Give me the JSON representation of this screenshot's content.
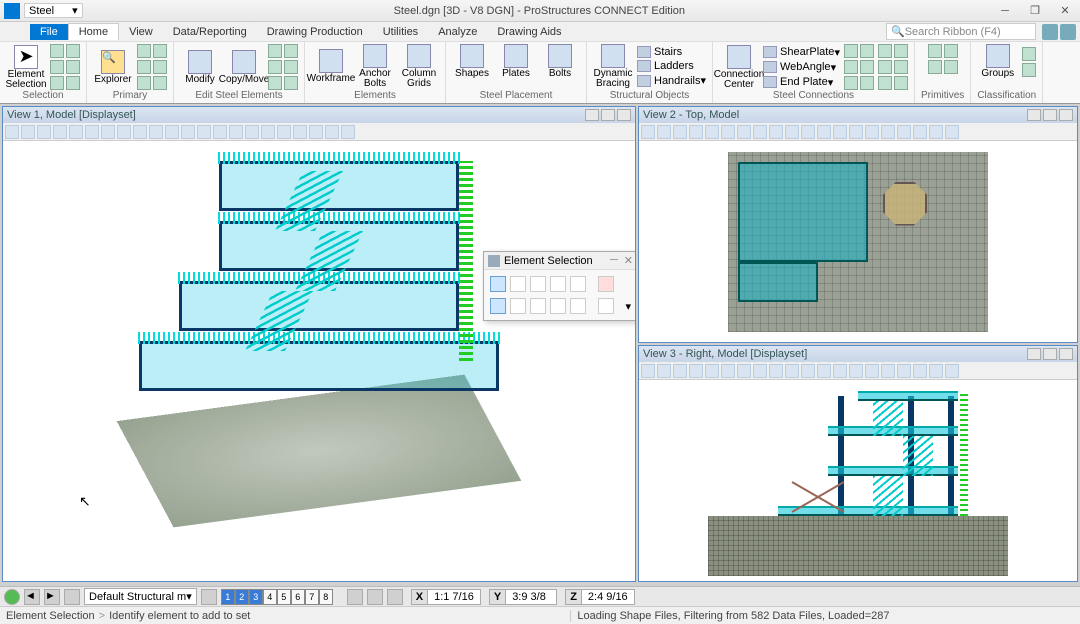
{
  "title": {
    "doc_name": "Steel",
    "center": "Steel.dgn [3D - V8 DGN] - ProStructures CONNECT Edition"
  },
  "win_btns": {
    "min": "─",
    "max": "❐",
    "close": "✕"
  },
  "menubar": {
    "file": "File",
    "tabs": [
      "Home",
      "View",
      "Data/Reporting",
      "Drawing Production",
      "Utilities",
      "Analyze",
      "Drawing Aids"
    ],
    "search_ph": "Search Ribbon (F4)"
  },
  "ribbon": {
    "selection": {
      "element": "Element\nSelection",
      "label": "Selection"
    },
    "primary": {
      "explorer": "Explorer",
      "label": "Primary"
    },
    "edit": {
      "modify": "Modify",
      "copymove": "Copy/Move",
      "label": "Edit Steel Elements"
    },
    "elements": {
      "workframe": "Workframe",
      "anchor": "Anchor\nBolts",
      "column": "Column\nGrids",
      "label": "Elements"
    },
    "placement": {
      "shapes": "Shapes",
      "plates": "Plates",
      "bolts": "Bolts",
      "label": "Steel Placement"
    },
    "structural": {
      "dynamic": "Dynamic\nBracing",
      "stairs": "Stairs",
      "ladders": "Ladders",
      "handrails": "Handrails",
      "label": "Structural Objects"
    },
    "connections": {
      "center": "Connection\nCenter",
      "shear": "ShearPlate",
      "web": "WebAngle",
      "end": "End Plate",
      "label": "Steel Connections"
    },
    "primitives": {
      "label": "Primitives"
    },
    "classification": {
      "groups": "Groups",
      "label": "Classification"
    }
  },
  "views": {
    "v1": "View 1, Model [Displayset]",
    "v2": "View 2 - Top, Model",
    "v3": "View 3 - Right, Model [Displayset]"
  },
  "float_tool": {
    "title": "Element Selection"
  },
  "status": {
    "model_dd": "Default Structural m",
    "viewbtns": [
      "1",
      "2",
      "3",
      "4",
      "5",
      "6",
      "7",
      "8"
    ],
    "x": {
      "l": "X",
      "v": "1:1 7/16"
    },
    "y": {
      "l": "Y",
      "v": "3:9 3/8"
    },
    "z": {
      "l": "Z",
      "v": "2:4 9/16"
    },
    "prompt_a": "Element Selection",
    "prompt_b": "Identify element to add to set",
    "loading": "Loading Shape Files, Filtering from 582 Data Files, Loaded=287"
  }
}
